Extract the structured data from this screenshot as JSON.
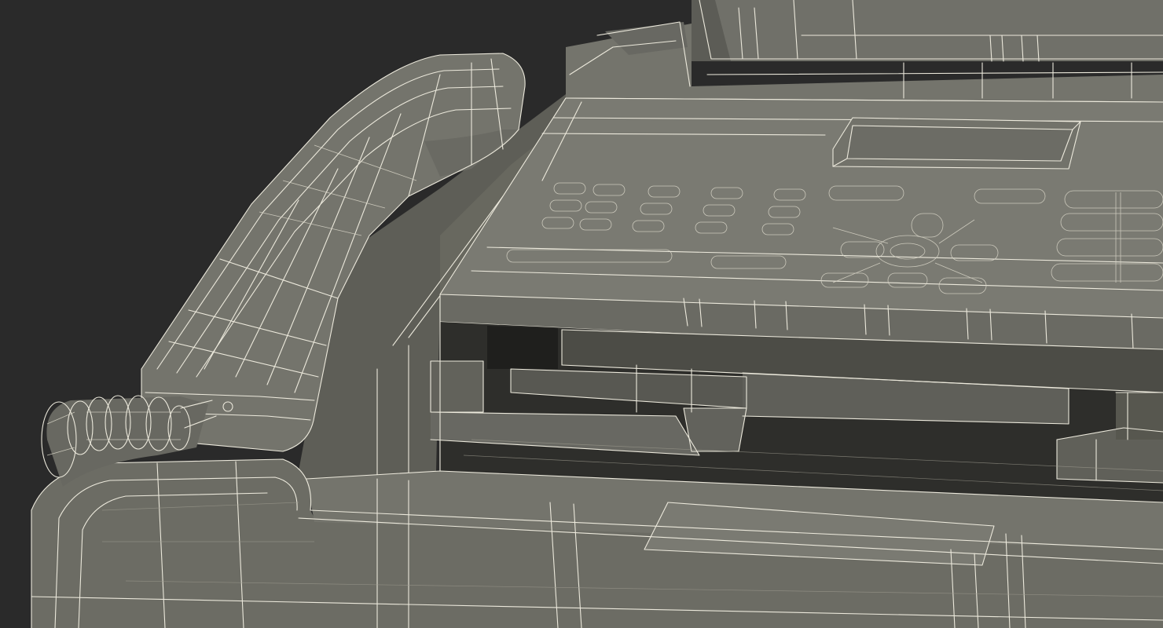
{
  "scene": {
    "background_color": "#2a2a2a",
    "surface_color": "#6e6e66",
    "surface_shadow_color": "#55554e",
    "surface_dark_color": "#3a3a36",
    "wire_color": "#ece9dc"
  }
}
